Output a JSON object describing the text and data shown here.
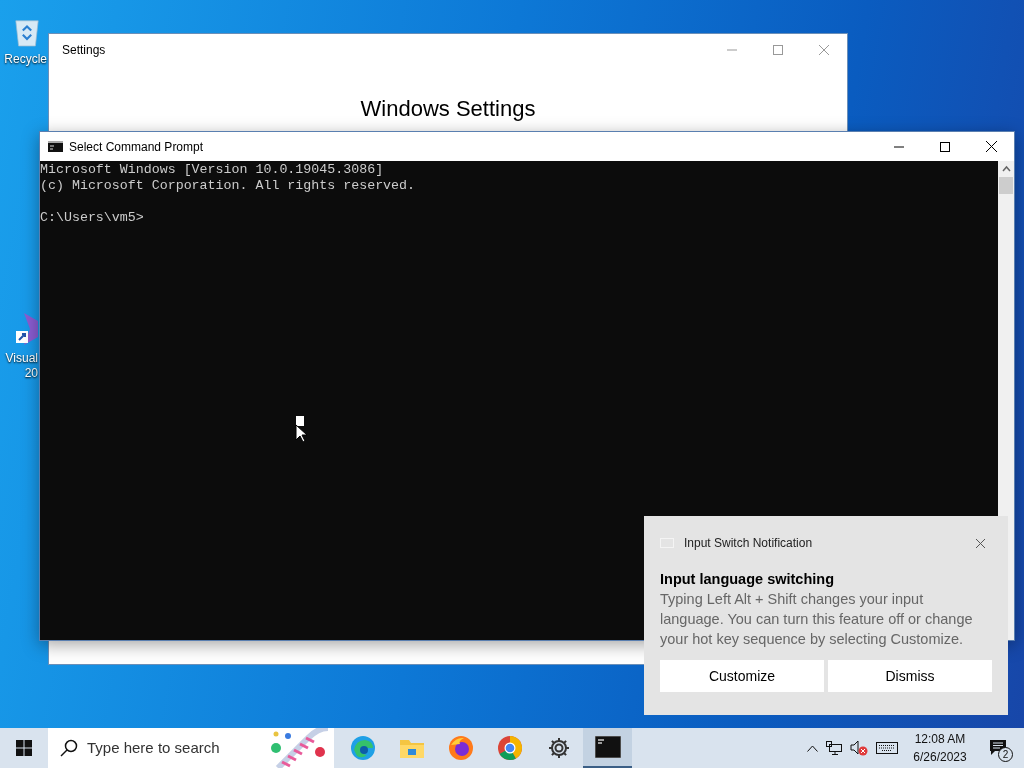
{
  "desktop_icons": [
    {
      "kind": "recycle",
      "label_lines": [
        "Recycle"
      ]
    },
    {
      "kind": "studio",
      "label_lines": [
        "Visual",
        "20"
      ]
    }
  ],
  "settings_window": {
    "title": "Settings",
    "heading": "Windows Settings"
  },
  "console_window": {
    "title": "Select Command Prompt",
    "blocks": [
      [
        "Microsoft Windows [Version 10.0.19045.3086]",
        "(c) Microsoft Corporation. All rights reserved."
      ],
      [
        "C:\\Users\\vm5>"
      ]
    ]
  },
  "notification": {
    "app": "Input Switch Notification",
    "title": "Input language switching",
    "body": "Typing Left Alt + Shift changes your input language. You can turn this feature off or change your hot key sequence by selecting Customize.",
    "buttons": [
      "Customize",
      "Dismiss"
    ]
  },
  "taskbar": {
    "search": {
      "placeholder": "Type here to search"
    },
    "apps": [
      {
        "kind": "edge",
        "selected": false
      },
      {
        "kind": "explorer",
        "selected": false
      },
      {
        "kind": "firefox",
        "selected": false
      },
      {
        "kind": "chrome",
        "selected": false
      },
      {
        "kind": "settings",
        "selected": false
      },
      {
        "kind": "console",
        "selected": true
      }
    ],
    "time": "12:08 AM",
    "date": "6/26/2023",
    "notification_count": "2"
  }
}
